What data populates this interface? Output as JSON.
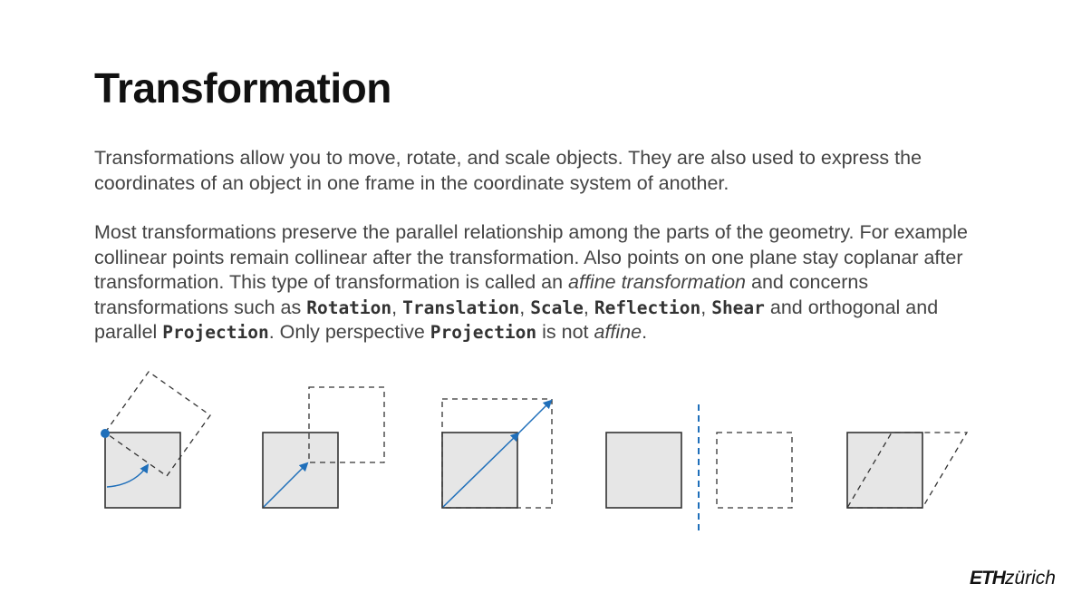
{
  "title": "Transformation",
  "paragraph1": "Transformations allow you to move, rotate, and scale objects. They are also used to express the coordinates of an object in one frame in the coordinate system of another.",
  "paragraph2": {
    "s1": "Most transformations preserve the parallel relationship among the parts of the geometry. For example collinear points remain collinear after the transformation. Also points on one plane stay coplanar after transformation. This type of transformation is called an ",
    "em1": "affine transformation",
    "s2": " and concerns transformations such as ",
    "c_rotation": "Rotation",
    "comma1": ", ",
    "c_translation": "Translation",
    "comma2": ", ",
    "c_scale": "Scale",
    "comma3": ", ",
    "c_reflection": "Reflection",
    "comma4": ", ",
    "c_shear": "Shear",
    "s3": " and orthogonal and parallel ",
    "c_projection1": "Projection",
    "s4": ". Only perspective ",
    "c_projection2": "Projection",
    "s5": " is not ",
    "em2": "affine",
    "s6": "."
  },
  "figures": [
    "rotation-figure",
    "translation-figure",
    "scale-figure",
    "reflection-figure",
    "shear-figure"
  ],
  "colors": {
    "fill": "#e6e6e6",
    "stroke": "#333333",
    "accent": "#1f6fba"
  },
  "logo": {
    "eth": "ETH",
    "zurich": "zürich"
  }
}
